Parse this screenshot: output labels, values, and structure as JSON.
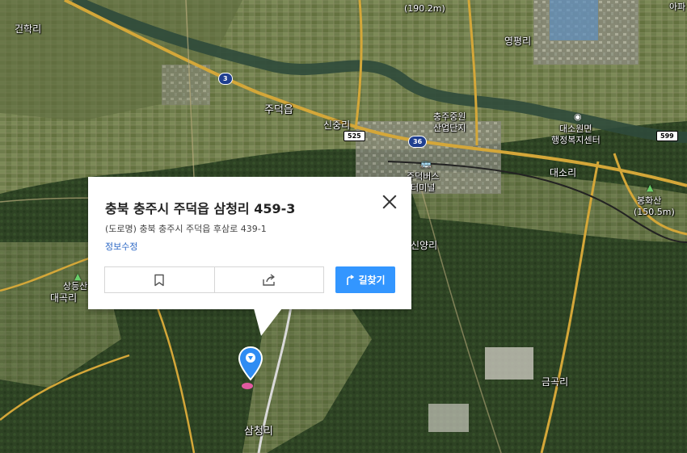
{
  "popup": {
    "title": "충북 충주시 주덕읍 삼청리 459-3",
    "road_address": "(도로명) 충북 충주시 주덕읍 후삼로 439-1",
    "edit_link": "정보수정",
    "route_label": "길찾기",
    "save_icon": "bookmark-icon",
    "share_icon": "share-icon"
  },
  "map_labels": {
    "gunhak": "건학리",
    "elev_top": "(190.2m)",
    "apt": "아파",
    "yeongpyeong": "영평리",
    "judeok": "주덕읍",
    "sinjung": "신중리",
    "industrial_1": "충주중원",
    "industrial_2": "산업단지",
    "daeso_1": "대소원면",
    "daeso_2": "행정복지센터",
    "terminal_1": "주덕버스",
    "terminal_2": "터미널",
    "daeso_ri": "대소리",
    "bonghwa_1": "봉화산",
    "bonghwa_2": "(150.5m)",
    "sinyang": "신양리",
    "sangdeung": "상등산",
    "daegok": "대곡리",
    "geumgok": "금곡리",
    "samcheong": "삼청리"
  },
  "roads": {
    "r3": "3",
    "r525": "525",
    "r36": "36",
    "r599": "599"
  },
  "colors": {
    "route_button": "#3396ff",
    "pin": "#2f8cf3",
    "pin_base": "#e15aa0"
  }
}
